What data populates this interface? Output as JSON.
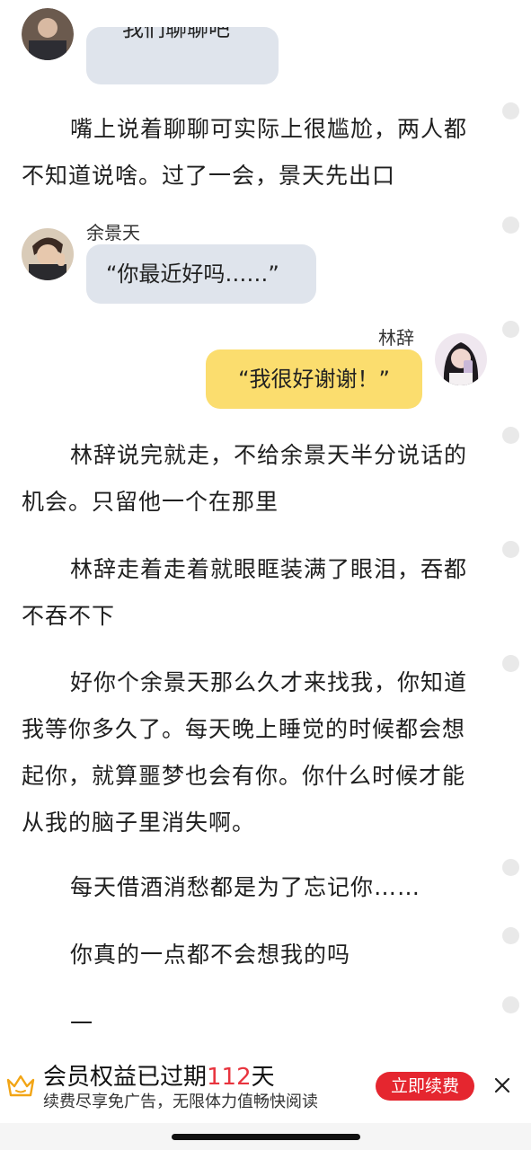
{
  "story": {
    "msg0": {
      "text": "我们聊聊吧"
    },
    "para1": "嘴上说着聊聊可实际上很尴尬，两人都不知道说啥。过了一会，景天先出口",
    "msg1": {
      "sender": "余景天",
      "text": "“你最近好吗……”"
    },
    "msg2": {
      "sender": "林辞",
      "text": "“我很好谢谢！”"
    },
    "para2": "林辞说完就走，不给余景天半分说话的机会。只留他一个在那里",
    "para3": "林辞走着走着就眼眶装满了眼泪，吞都不吞不下",
    "para4": "好你个余景天那么久才来找我，你知道我等你多久了。每天晚上睡觉的时候都会想起你，就算噩梦也会有你。你什么时候才能从我的脑子里消失啊。",
    "para5": "每天借酒消愁都是为了忘记你……",
    "para6": "你真的一点都不会想我的吗",
    "para7": "一"
  },
  "banner": {
    "title_prefix": "会员权益已过期",
    "days": "112",
    "title_suffix": "天",
    "subtitle": "续费尽享免广告，无限体力值畅快阅读",
    "renew_label": "立即续费"
  },
  "icons": {
    "crown": "crown-icon",
    "close": "close-icon",
    "comment_dot": "comment-dot-icon"
  },
  "colors": {
    "left_bubble": "#dfe4ec",
    "right_bubble": "#fbdd6e",
    "renew_button": "#e5262f",
    "days_accent": "#e8343e"
  }
}
